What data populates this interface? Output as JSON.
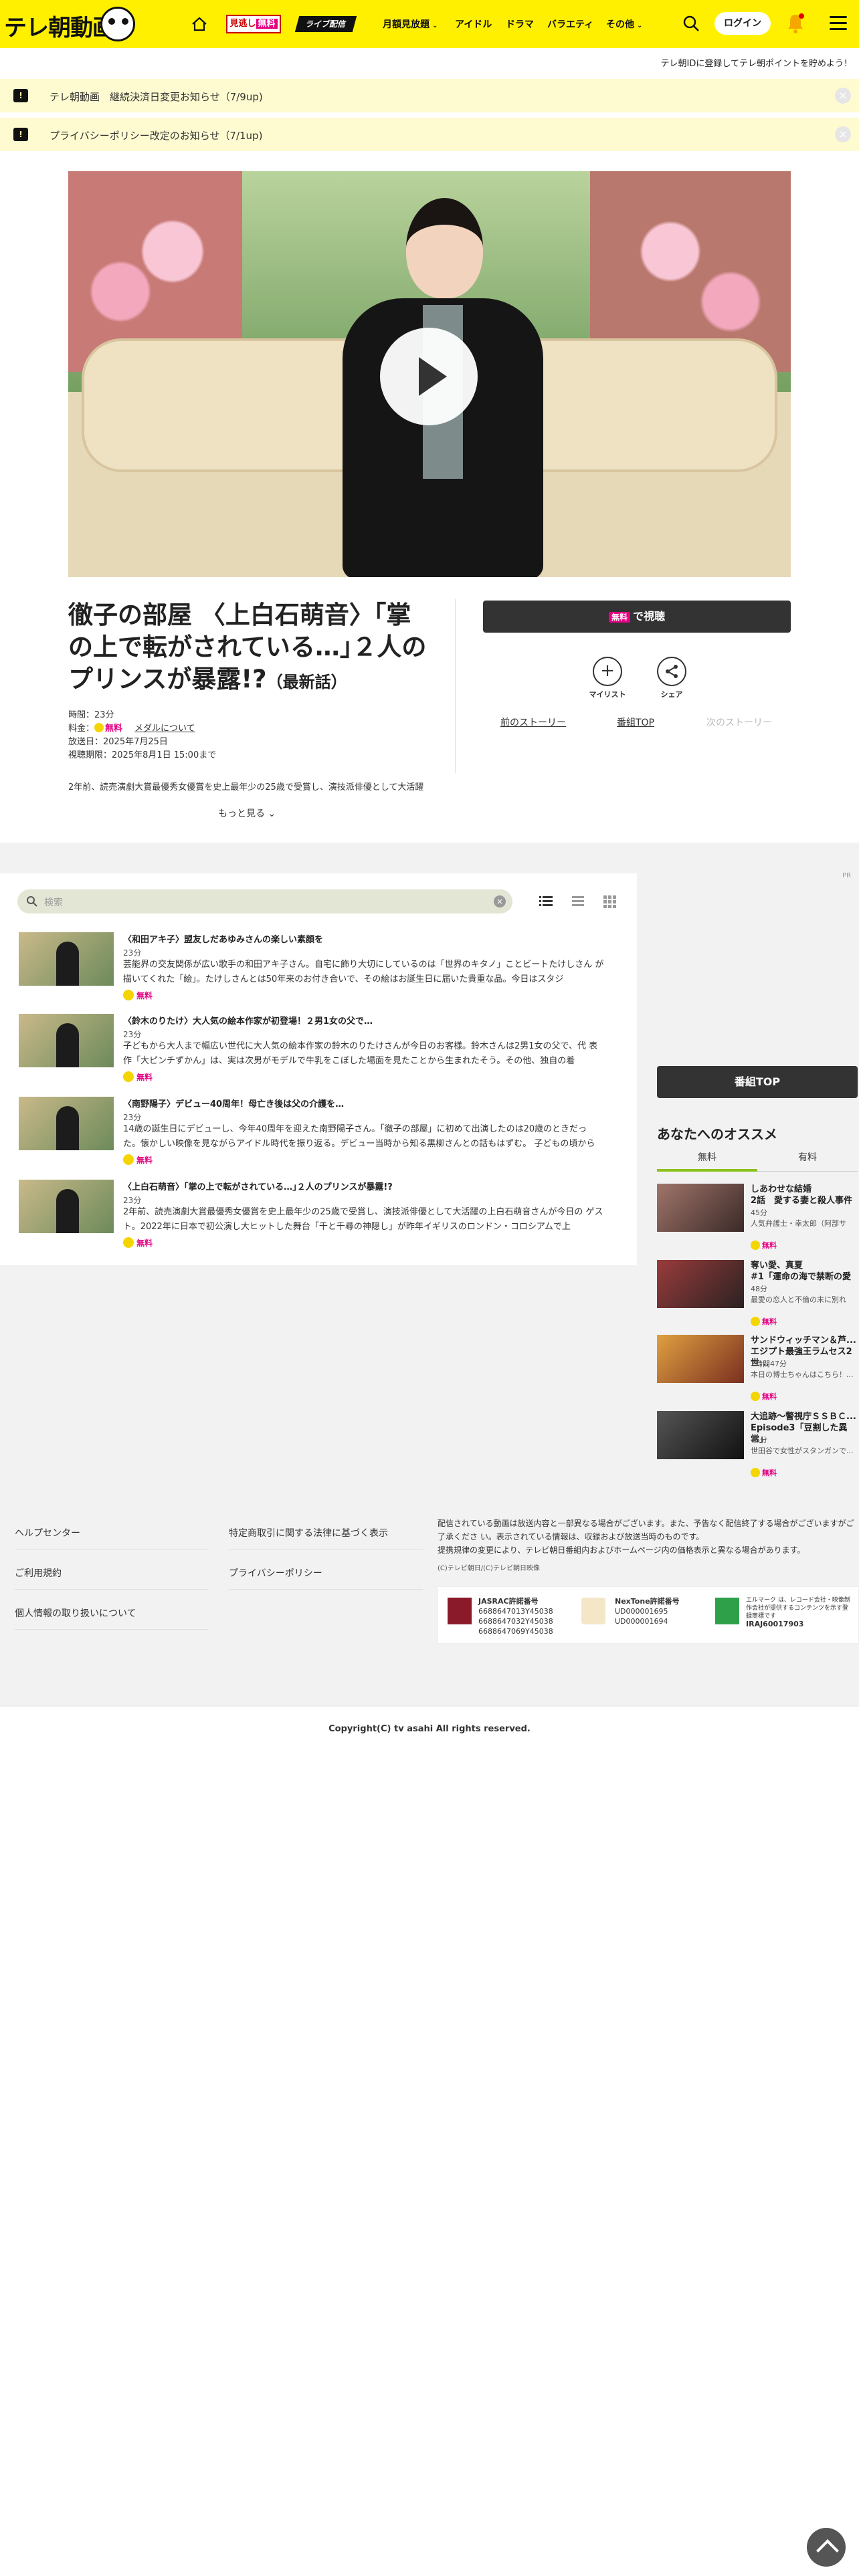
{
  "header": {
    "logo_text": "テレ朝動画",
    "tver_badge": {
      "prefix": "見逃し",
      "free": "無料"
    },
    "live_badge": "ライブ配信",
    "nav": [
      {
        "label": "月額見放題",
        "chevron": true
      },
      {
        "label": "アイドル",
        "chevron": false
      },
      {
        "label": "ドラマ",
        "chevron": false
      },
      {
        "label": "バラエティ",
        "chevron": false
      },
      {
        "label": "その他",
        "chevron": true
      }
    ],
    "login": "ログイン",
    "promo": "テレ朝IDに登録してテレ朝ポイントを貯めよう！"
  },
  "notices": [
    {
      "icon": "!",
      "text": "テレ朝動画　継続決済日変更お知らせ（7/9up)"
    },
    {
      "icon": "!",
      "text": "プライバシーポリシー改定のお知らせ（7/1up)"
    }
  ],
  "episode": {
    "title": "徹子の部屋 〈上白石萌音〉｢掌の上で転がされている…｣２人のプリンスが暴露!?",
    "title_suffix": "（最新話）",
    "duration": "時間：23分",
    "price_label": "料金：",
    "price_free": "無料",
    "medal_link": "メダルについて",
    "aired": "放送日：2025年7月25日",
    "deadline": "視聴期限：2025年8月1日 15:00まで",
    "description": "2年前、読売演劇大賞最優秀女優賞を史上最年少の25歳で受賞し、演技派俳優として大活躍",
    "more": "もっと見る",
    "watch": {
      "free": "無料",
      "label": "で視聴"
    },
    "mylist": "マイリスト",
    "share": "シェア",
    "prev_story": "前のストーリー",
    "program_top": "番組TOP",
    "next_story": "次のストーリー"
  },
  "pr_tag": "PR",
  "list": {
    "search_placeholder": "検索",
    "items": [
      {
        "title": "〈和田アキ子〉盟友しだあゆみさんの楽しい素顔を",
        "duration": "23分",
        "text": "芸能界の交友関係が広い歌手の和田アキ子さん。自宅に飾り大切にしているのは「世界のキタノ」ことビートたけしさん が描いてくれた「絵」。たけしさんとは50年来のお付き合いで、その絵はお誕生日に届いた貴重な品。今日はスタジ",
        "free": "無料"
      },
      {
        "title": "〈鈴木のりたけ〉大人気の絵本作家が初登場！２男1女の父で…",
        "duration": "23分",
        "text": "子どもから大人まで幅広い世代に大人気の絵本作家の鈴木のりたけさんが今日のお客様。鈴木さんは2男1女の父で、代 表作「大ピンチずかん」は、実は次男がモデルで牛乳をこぼした場面を見たことから生まれたそう。その他、独自の着",
        "free": "無料"
      },
      {
        "title": "〈南野陽子〉デビュー40周年！母亡き後は父の介護を…",
        "duration": "23分",
        "text": "14歳の誕生日にデビューし、今年40周年を迎えた南野陽子さん。「徹子の部屋」に初めて出演したのは20歳のときだっ た。懐かしい映像を見ながらアイドル時代を振り返る。デビュー当時から知る黒柳さんとの話もはずむ。 子どもの頃から",
        "free": "無料"
      },
      {
        "title": "〈上白石萌音〉｢掌の上で転がされている…｣２人のプリンスが暴露!?",
        "duration": "23分",
        "text": "2年前、読売演劇大賞最優秀女優賞を史上最年少の25歳で受賞し、演技派俳優として大活躍の上白石萌音さんが今日の ゲスト。2022年に日本で初公演し大ヒットした舞台「千と千尋の神隠し」が昨年イギリスのロンドン・コロシアムで上",
        "free": "無料"
      }
    ]
  },
  "sidebar": {
    "program_top": "番組TOP",
    "rec_heading": "あなたへのオススメ",
    "tabs": [
      "無料",
      "有料"
    ],
    "items": [
      {
        "title": "しあわせな結婚",
        "sub": "2話　愛する妻と殺人事件",
        "duration": "45分",
        "text": "人気弁護士・幸太郎（阿部サ",
        "free": "無料"
      },
      {
        "title": "奪い愛、真夏",
        "sub": "#1「運命の海で禁断の愛",
        "duration": "48分",
        "text": "最愛の恋人と不倫の末に別れ",
        "free": "無料"
      },
      {
        "title": "サンドウィッチマン＆芦...",
        "sub": "エジプト最強王ラムセス2世...",
        "duration": "2時間47分",
        "text": "本日の博士ちゃんはこちら！...",
        "free": "無料"
      },
      {
        "title": "大追跡～警視庁ＳＳＢＣ...",
        "sub": "Episode3「豆割した異常」",
        "duration": "45分",
        "text": "世田谷で女性がスタンガンで...",
        "free": "無料"
      }
    ]
  },
  "footer": {
    "links_left": [
      "ヘルプセンター",
      "ご利用規約",
      "個人情報の取り扱いについて"
    ],
    "links_mid": [
      "特定商取引に関する法律に基づく表示",
      "プライバシーポリシー"
    ],
    "note1": "配信されている動画は放送内容と一部異なる場合がございます。また、予告なく配信終了する場合がございますがご了承くださ い。表示されている情報は、収録および放送当時のものです。",
    "note2": "提携規律の変更により、テレビ朝日番組内およびホームページ内の価格表示と異なる場合があります。",
    "copy_small": "(C)テレビ朝日/(C)テレビ朝日映像",
    "licenses": [
      {
        "name": "JASRAC許諾番号",
        "lines": [
          "6688647013Y45038",
          "6688647032Y45038",
          "6688647069Y45038"
        ]
      },
      {
        "name": "NexTone許諾番号",
        "lines": [
          "UD000001695",
          "UD000001694"
        ]
      },
      {
        "name": "IRAJ60017903",
        "lines": [
          "エルマーク は、レコード会社・映像制作会社が提供するコンテンツを示す登録商標です"
        ]
      }
    ],
    "copyright": "Copyright(C) tv asahi All rights reserved."
  },
  "colors": {
    "brand_yellow": "#fff000",
    "free_pink": "#e40082",
    "tab_green": "#8cc220"
  }
}
